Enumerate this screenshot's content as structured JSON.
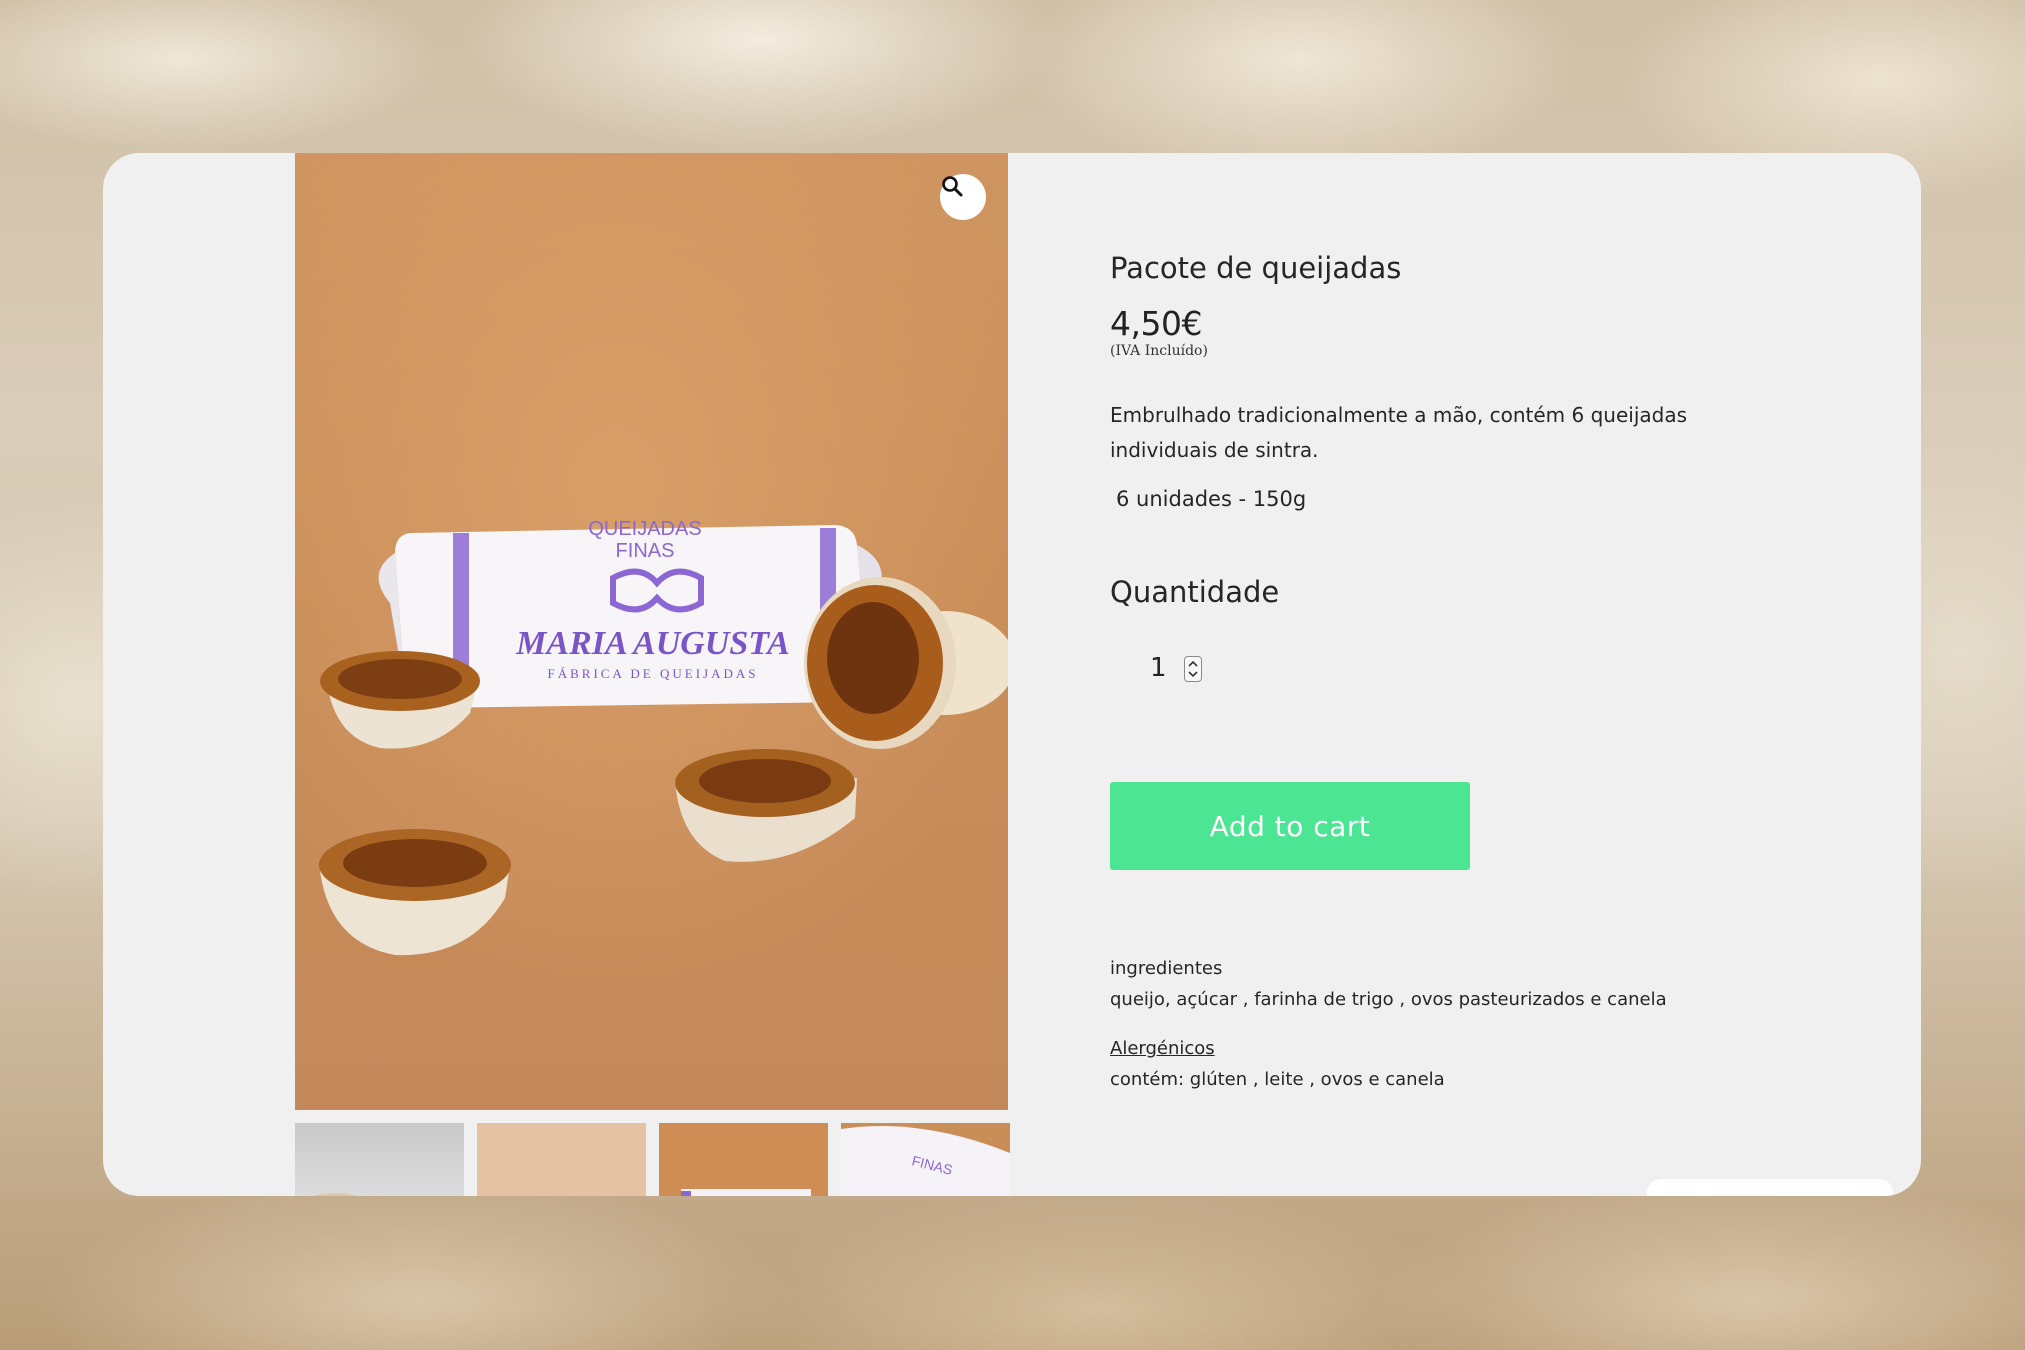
{
  "product": {
    "title": "Pacote de queijadas",
    "price": "4,50€",
    "vat_note": "(IVA Incluído)",
    "description": "Embrulhado tradicionalmente a mão, contém 6 queijadas individuais de sintra.",
    "units": "6 unidades - 150g"
  },
  "photo": {
    "brand_top": "QUEIJADAS",
    "brand_sub_top": "FINAS",
    "brand_name": "MARIA AUGUSTA",
    "brand_tagline": "FÁBRICA DE QUEIJADAS",
    "thumb_text": "FINAS",
    "brand_color": "#7a55c7"
  },
  "quantity": {
    "label": "Quantidade",
    "value": "1"
  },
  "cart": {
    "button_label": "Add to cart",
    "button_color": "#4ce594"
  },
  "ingredients": {
    "title": "ingredientes",
    "text": "queijo, açúcar , farinha de trigo , ovos pasteurizados e canela"
  },
  "allergens": {
    "title": "Alergénicos",
    "text": "contém: glúten , leite , ovos e canela"
  },
  "icons": {
    "zoom": "magnifier-icon"
  }
}
